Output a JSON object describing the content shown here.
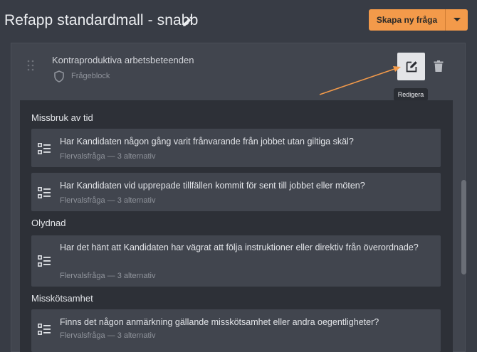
{
  "header": {
    "title": "Refapp standardmall - snabb",
    "create_button_label": "Skapa ny fråga"
  },
  "block": {
    "title": "Kontraproduktiva arbetsbeteenden",
    "type_label": "Frågeblock",
    "edit_tooltip": "Redigera"
  },
  "sections": [
    {
      "title": "Missbruk av tid",
      "questions": [
        {
          "text": "Har Kandidaten någon gång varit frånvarande från jobbet utan giltiga skäl?",
          "meta": "Flervalsfråga — 3 alternativ"
        },
        {
          "text": "Har Kandidaten vid upprepade tillfällen kommit för sent till jobbet eller möten?",
          "meta": "Flervalsfråga — 3 alternativ"
        }
      ]
    },
    {
      "title": "Olydnad",
      "questions": [
        {
          "text": "Har det hänt att Kandidaten har vägrat att följa instruktioner eller direktiv från överordnade?",
          "meta": "Flervalsfråga — 3 alternativ"
        }
      ]
    },
    {
      "title": "Misskötsamhet",
      "questions": [
        {
          "text": "Finns det någon anmärkning gällande misskötsamhet eller andra oegentligheter?",
          "meta": "Flervalsfråga — 3 alternativ"
        }
      ]
    }
  ],
  "colors": {
    "accent": "#f39a4a",
    "annotation_arrow": "#f39a4a",
    "background": "#383c45",
    "card": "#41454e",
    "inner_panel": "#2d3037"
  }
}
